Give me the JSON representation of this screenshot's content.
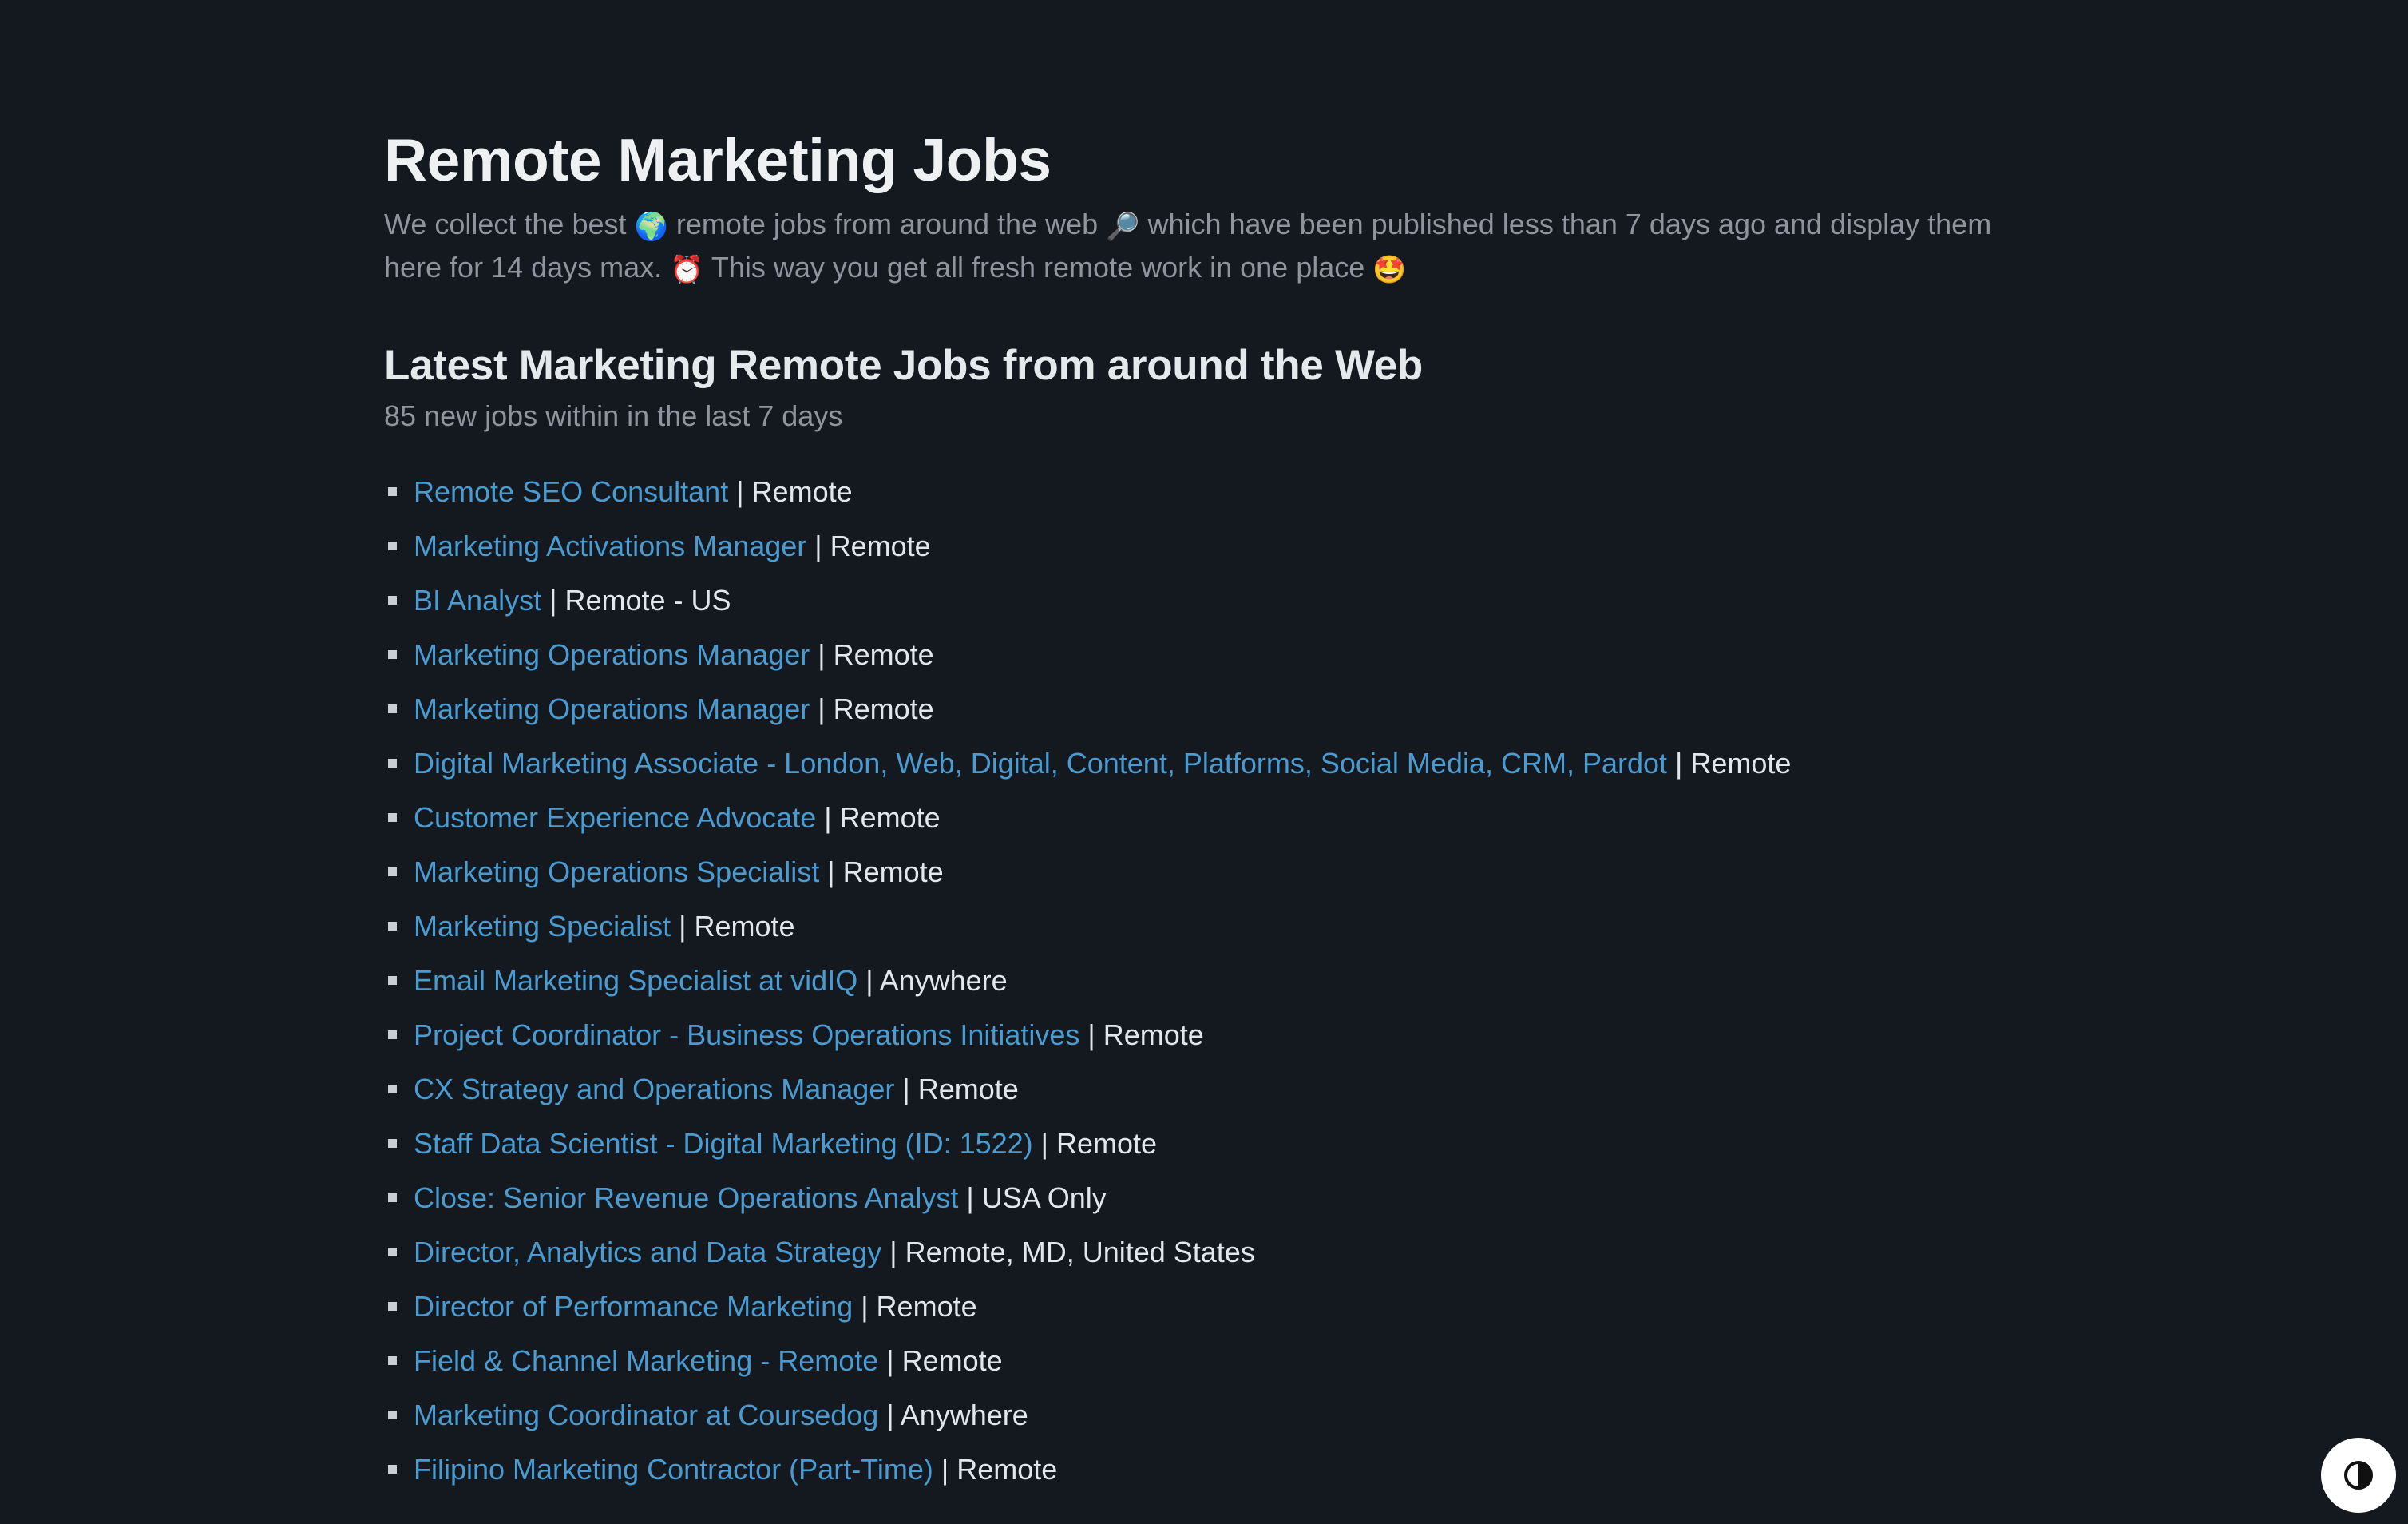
{
  "page": {
    "title": "Remote Marketing Jobs",
    "intro": {
      "part1": "We collect the best ",
      "emoji1": "🌍",
      "part2": " remote jobs from around the web ",
      "emoji2": "🔎",
      "part3": " which have been published less than 7 days ago and display them here for 14 days max. ",
      "emoji3": "⏰",
      "part4": " This way you get all fresh remote work in one place ",
      "emoji4": "🤩"
    },
    "section_title": "Latest Marketing Remote Jobs from around the Web",
    "job_count_text": "85 new jobs within in the last 7 days"
  },
  "jobs": [
    {
      "title": "Remote SEO Consultant",
      "location": " | Remote"
    },
    {
      "title": "Marketing Activations Manager",
      "location": " | Remote"
    },
    {
      "title": "BI Analyst",
      "location": " | Remote - US"
    },
    {
      "title": "Marketing Operations Manager",
      "location": " | Remote"
    },
    {
      "title": "Marketing Operations Manager",
      "location": " | Remote"
    },
    {
      "title": "Digital Marketing Associate - London, Web, Digital, Content, Platforms, Social Media, CRM, Pardot",
      "location": " | Remote"
    },
    {
      "title": "Customer Experience Advocate",
      "location": " | Remote"
    },
    {
      "title": "Marketing Operations Specialist",
      "location": " | Remote"
    },
    {
      "title": "Marketing Specialist",
      "location": " | Remote"
    },
    {
      "title": "Email Marketing Specialist at vidIQ",
      "location": " | Anywhere"
    },
    {
      "title": "Project Coordinator - Business Operations Initiatives",
      "location": " | Remote"
    },
    {
      "title": "CX Strategy and Operations Manager",
      "location": " | Remote"
    },
    {
      "title": "Staff Data Scientist - Digital Marketing (ID: 1522)",
      "location": " | Remote"
    },
    {
      "title": "Close: Senior Revenue Operations Analyst",
      "location": " | USA Only"
    },
    {
      "title": "Director, Analytics and Data Strategy",
      "location": " | Remote, MD, United States"
    },
    {
      "title": "Director of Performance Marketing",
      "location": " | Remote"
    },
    {
      "title": "Field & Channel Marketing - Remote",
      "location": " | Remote"
    },
    {
      "title": "Marketing Coordinator at Coursedog",
      "location": " | Anywhere"
    },
    {
      "title": "Filipino Marketing Contractor (Part-Time)",
      "location": " | Remote"
    }
  ],
  "theme_toggle": {
    "icon": "contrast-icon"
  },
  "colors": {
    "background": "#141920",
    "link": "#4a9bd1",
    "muted_text": "#8e959e",
    "heading": "#eef0f2"
  }
}
